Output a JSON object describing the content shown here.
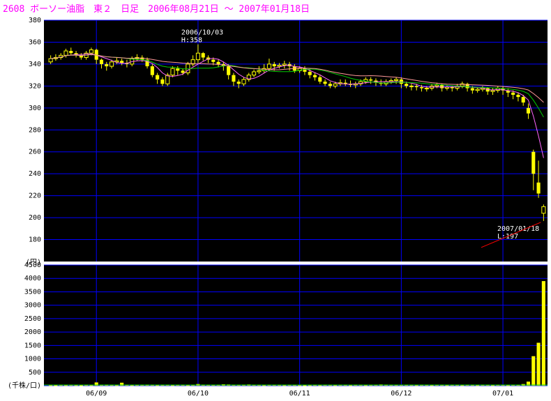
{
  "header": {
    "title": "2608 ボーソー油脂　東２　日足　2006年08月21日 ～ 2007年01月18日"
  },
  "colors": {
    "background": "#000000",
    "grid": "#0000ff",
    "up_candle": "#ffff00",
    "down_candle": "#ffff00",
    "ma_short": "#ff66ff",
    "ma_mid": "#00cc00",
    "ma_long": "#ff9999",
    "volume": "#ffff00",
    "title": "#ff00ff",
    "annotation_arrow": "#ff0000"
  },
  "chart_data": [
    {
      "type": "candlestick",
      "title": "2608 ボーソー油脂　東２　日足",
      "ylabel": "(円)",
      "ylim": [
        160,
        380
      ],
      "y_ticks": [
        380,
        360,
        340,
        320,
        300,
        280,
        260,
        240,
        220,
        200,
        180
      ],
      "x_tick_labels": [
        "06/09",
        "06/10",
        "06/11",
        "06/12",
        "07/01"
      ],
      "x_tick_index": [
        9,
        29,
        49,
        69,
        89
      ],
      "annotations": [
        {
          "label_date": "2006/10/03",
          "label_value": "H:358",
          "index": 29,
          "price": 358
        },
        {
          "label_date": "2007/01/18",
          "label_value": "L:197",
          "index": 97,
          "price": 197
        }
      ],
      "series": [
        {
          "name": "candles",
          "open": [
            342,
            345,
            346,
            348,
            352,
            350,
            348,
            346,
            350,
            353,
            344,
            340,
            338,
            342,
            343,
            341,
            340,
            345,
            346,
            344,
            338,
            330,
            326,
            322,
            330,
            336,
            334,
            332,
            340,
            344,
            350,
            346,
            344,
            342,
            340,
            338,
            330,
            324,
            322,
            326,
            330,
            333,
            334,
            336,
            340,
            338,
            339,
            340,
            338,
            334,
            336,
            333,
            330,
            328,
            324,
            322,
            320,
            322,
            323,
            322,
            321,
            322,
            324,
            326,
            325,
            323,
            322,
            324,
            325,
            326,
            322,
            320,
            320,
            319,
            318,
            318,
            320,
            321,
            318,
            319,
            318,
            320,
            322,
            318,
            316,
            317,
            318,
            315,
            316,
            318,
            316,
            314,
            312,
            310,
            300,
            260,
            232,
            204
          ],
          "close": [
            345,
            346,
            348,
            352,
            350,
            348,
            346,
            350,
            353,
            344,
            340,
            338,
            342,
            343,
            341,
            340,
            345,
            346,
            344,
            338,
            330,
            326,
            322,
            330,
            336,
            334,
            332,
            340,
            344,
            350,
            346,
            344,
            342,
            340,
            338,
            330,
            324,
            322,
            326,
            330,
            333,
            334,
            336,
            340,
            338,
            339,
            340,
            338,
            334,
            336,
            333,
            330,
            328,
            324,
            322,
            320,
            322,
            323,
            322,
            321,
            322,
            324,
            326,
            325,
            323,
            322,
            324,
            325,
            326,
            322,
            320,
            320,
            319,
            318,
            318,
            320,
            321,
            318,
            319,
            318,
            320,
            322,
            318,
            316,
            317,
            318,
            315,
            316,
            318,
            316,
            314,
            312,
            310,
            305,
            295,
            240,
            222,
            210
          ],
          "high": [
            348,
            349,
            350,
            354,
            355,
            352,
            350,
            352,
            355,
            354,
            345,
            342,
            344,
            346,
            345,
            344,
            347,
            349,
            348,
            346,
            340,
            332,
            328,
            332,
            338,
            338,
            336,
            342,
            348,
            358,
            351,
            348,
            346,
            344,
            342,
            340,
            332,
            326,
            328,
            332,
            335,
            338,
            340,
            345,
            342,
            341,
            343,
            342,
            340,
            338,
            338,
            336,
            332,
            330,
            326,
            324,
            324,
            326,
            326,
            325,
            324,
            326,
            328,
            328,
            327,
            326,
            326,
            327,
            328,
            328,
            324,
            322,
            322,
            321,
            320,
            322,
            323,
            322,
            321,
            320,
            322,
            324,
            323,
            320,
            319,
            320,
            319,
            318,
            320,
            320,
            318,
            316,
            314,
            312,
            304,
            262,
            252,
            212
          ],
          "low": [
            340,
            343,
            344,
            346,
            348,
            346,
            344,
            344,
            348,
            340,
            336,
            334,
            336,
            340,
            339,
            337,
            338,
            343,
            342,
            336,
            328,
            322,
            320,
            320,
            328,
            330,
            330,
            330,
            338,
            341,
            343,
            341,
            339,
            337,
            334,
            326,
            320,
            318,
            320,
            324,
            328,
            331,
            332,
            334,
            334,
            336,
            336,
            334,
            332,
            332,
            330,
            327,
            325,
            322,
            320,
            318,
            318,
            320,
            320,
            319,
            318,
            320,
            322,
            322,
            320,
            320,
            320,
            322,
            322,
            318,
            318,
            316,
            316,
            315,
            315,
            316,
            318,
            315,
            316,
            315,
            316,
            318,
            315,
            313,
            314,
            315,
            312,
            312,
            314,
            312,
            310,
            308,
            306,
            302,
            290,
            225,
            218,
            197
          ]
        }
      ]
    },
    {
      "type": "line",
      "ylabel": "",
      "series": [
        {
          "name": "ma_short"
        },
        {
          "name": "ma_mid"
        },
        {
          "name": "ma_long"
        }
      ]
    },
    {
      "type": "bar",
      "ylabel": "(千株/口)",
      "ylim": [
        0,
        4500
      ],
      "y_ticks": [
        4500,
        4000,
        3500,
        3000,
        2500,
        2000,
        1500,
        1000,
        500,
        0
      ],
      "values": [
        20,
        15,
        25,
        20,
        30,
        20,
        15,
        25,
        20,
        120,
        30,
        40,
        25,
        20,
        110,
        30,
        20,
        25,
        35,
        40,
        30,
        20,
        25,
        30,
        20,
        25,
        30,
        20,
        25,
        60,
        40,
        30,
        25,
        35,
        50,
        45,
        30,
        25,
        40,
        45,
        30,
        25,
        20,
        35,
        30,
        25,
        20,
        30,
        25,
        20,
        15,
        20,
        25,
        20,
        30,
        25,
        20,
        30,
        25,
        20,
        35,
        30,
        20,
        25,
        30,
        45,
        40,
        30,
        25,
        35,
        30,
        25,
        20,
        30,
        25,
        20,
        30,
        25,
        20,
        30,
        25,
        20,
        30,
        25,
        20,
        30,
        25,
        20,
        30,
        25,
        20,
        30,
        25,
        60,
        150,
        1100,
        1600,
        3900
      ]
    }
  ]
}
